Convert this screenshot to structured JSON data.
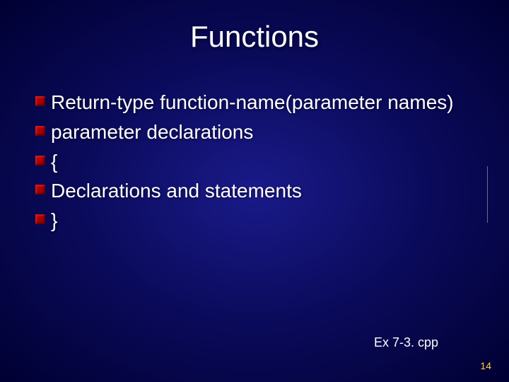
{
  "slide": {
    "title": "Functions",
    "bullets": [
      "Return-type function-name(parameter names)",
      "parameter declarations",
      "{",
      "Declarations and statements",
      "}"
    ],
    "footerNote": "Ex 7-3. cpp",
    "pageNumber": "14"
  }
}
